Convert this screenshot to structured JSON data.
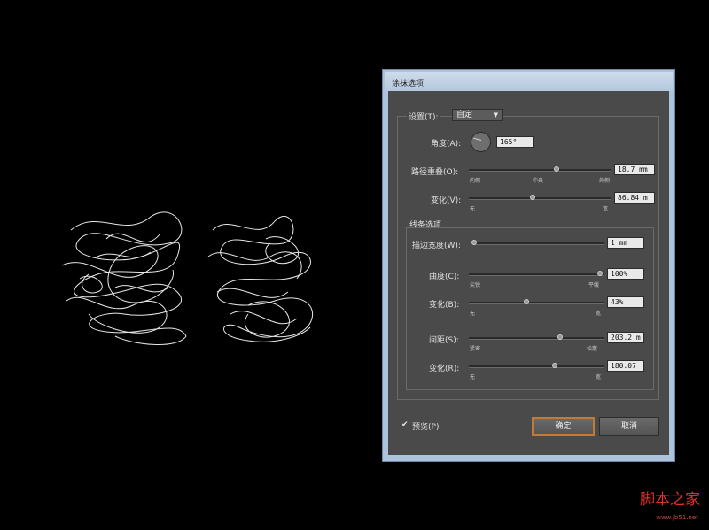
{
  "dialog": {
    "title": "涂抹选项",
    "settings": {
      "label": "设置(T):",
      "value": "自定",
      "arrow": "▼"
    },
    "angle": {
      "label": "角度(A):",
      "value": "165°"
    },
    "path_overlap": {
      "label": "路径重叠(O):",
      "value": "18.7 mm",
      "min": "内侧",
      "mid": "中央",
      "max": "外侧",
      "level": 0.62
    },
    "variation1": {
      "label": "变化(V):",
      "value": "86.84 m",
      "min": "无",
      "max": "宽",
      "level": 0.45
    },
    "line_options": {
      "title": "线条选项"
    },
    "stroke_width": {
      "label": "描边宽度(W):",
      "value": "1 mm",
      "level": 0.02
    },
    "curviness": {
      "label": "曲度(C):",
      "value": "100%",
      "min": "尖锐",
      "max": "平缓",
      "level": 0.98
    },
    "variation2": {
      "label": "变化(B):",
      "value": "43%",
      "min": "无",
      "max": "宽",
      "level": 0.43
    },
    "spacing": {
      "label": "间距(S):",
      "value": "203.2 m",
      "min": "紧密",
      "max": "松散",
      "level": 0.67
    },
    "variation3": {
      "label": "变化(R):",
      "value": "180.07",
      "min": "无",
      "max": "宽",
      "level": 0.62
    },
    "preview": {
      "label": "预览(P)",
      "checked": true
    },
    "ok_label": "确定",
    "cancel_label": "取消"
  },
  "watermark": {
    "text": "脚本之家",
    "url": "www.jb51.net"
  },
  "colors": {
    "dialog_bg": "#4a4a4a",
    "frame": "#adc3dc",
    "accent": "#c47a35"
  }
}
